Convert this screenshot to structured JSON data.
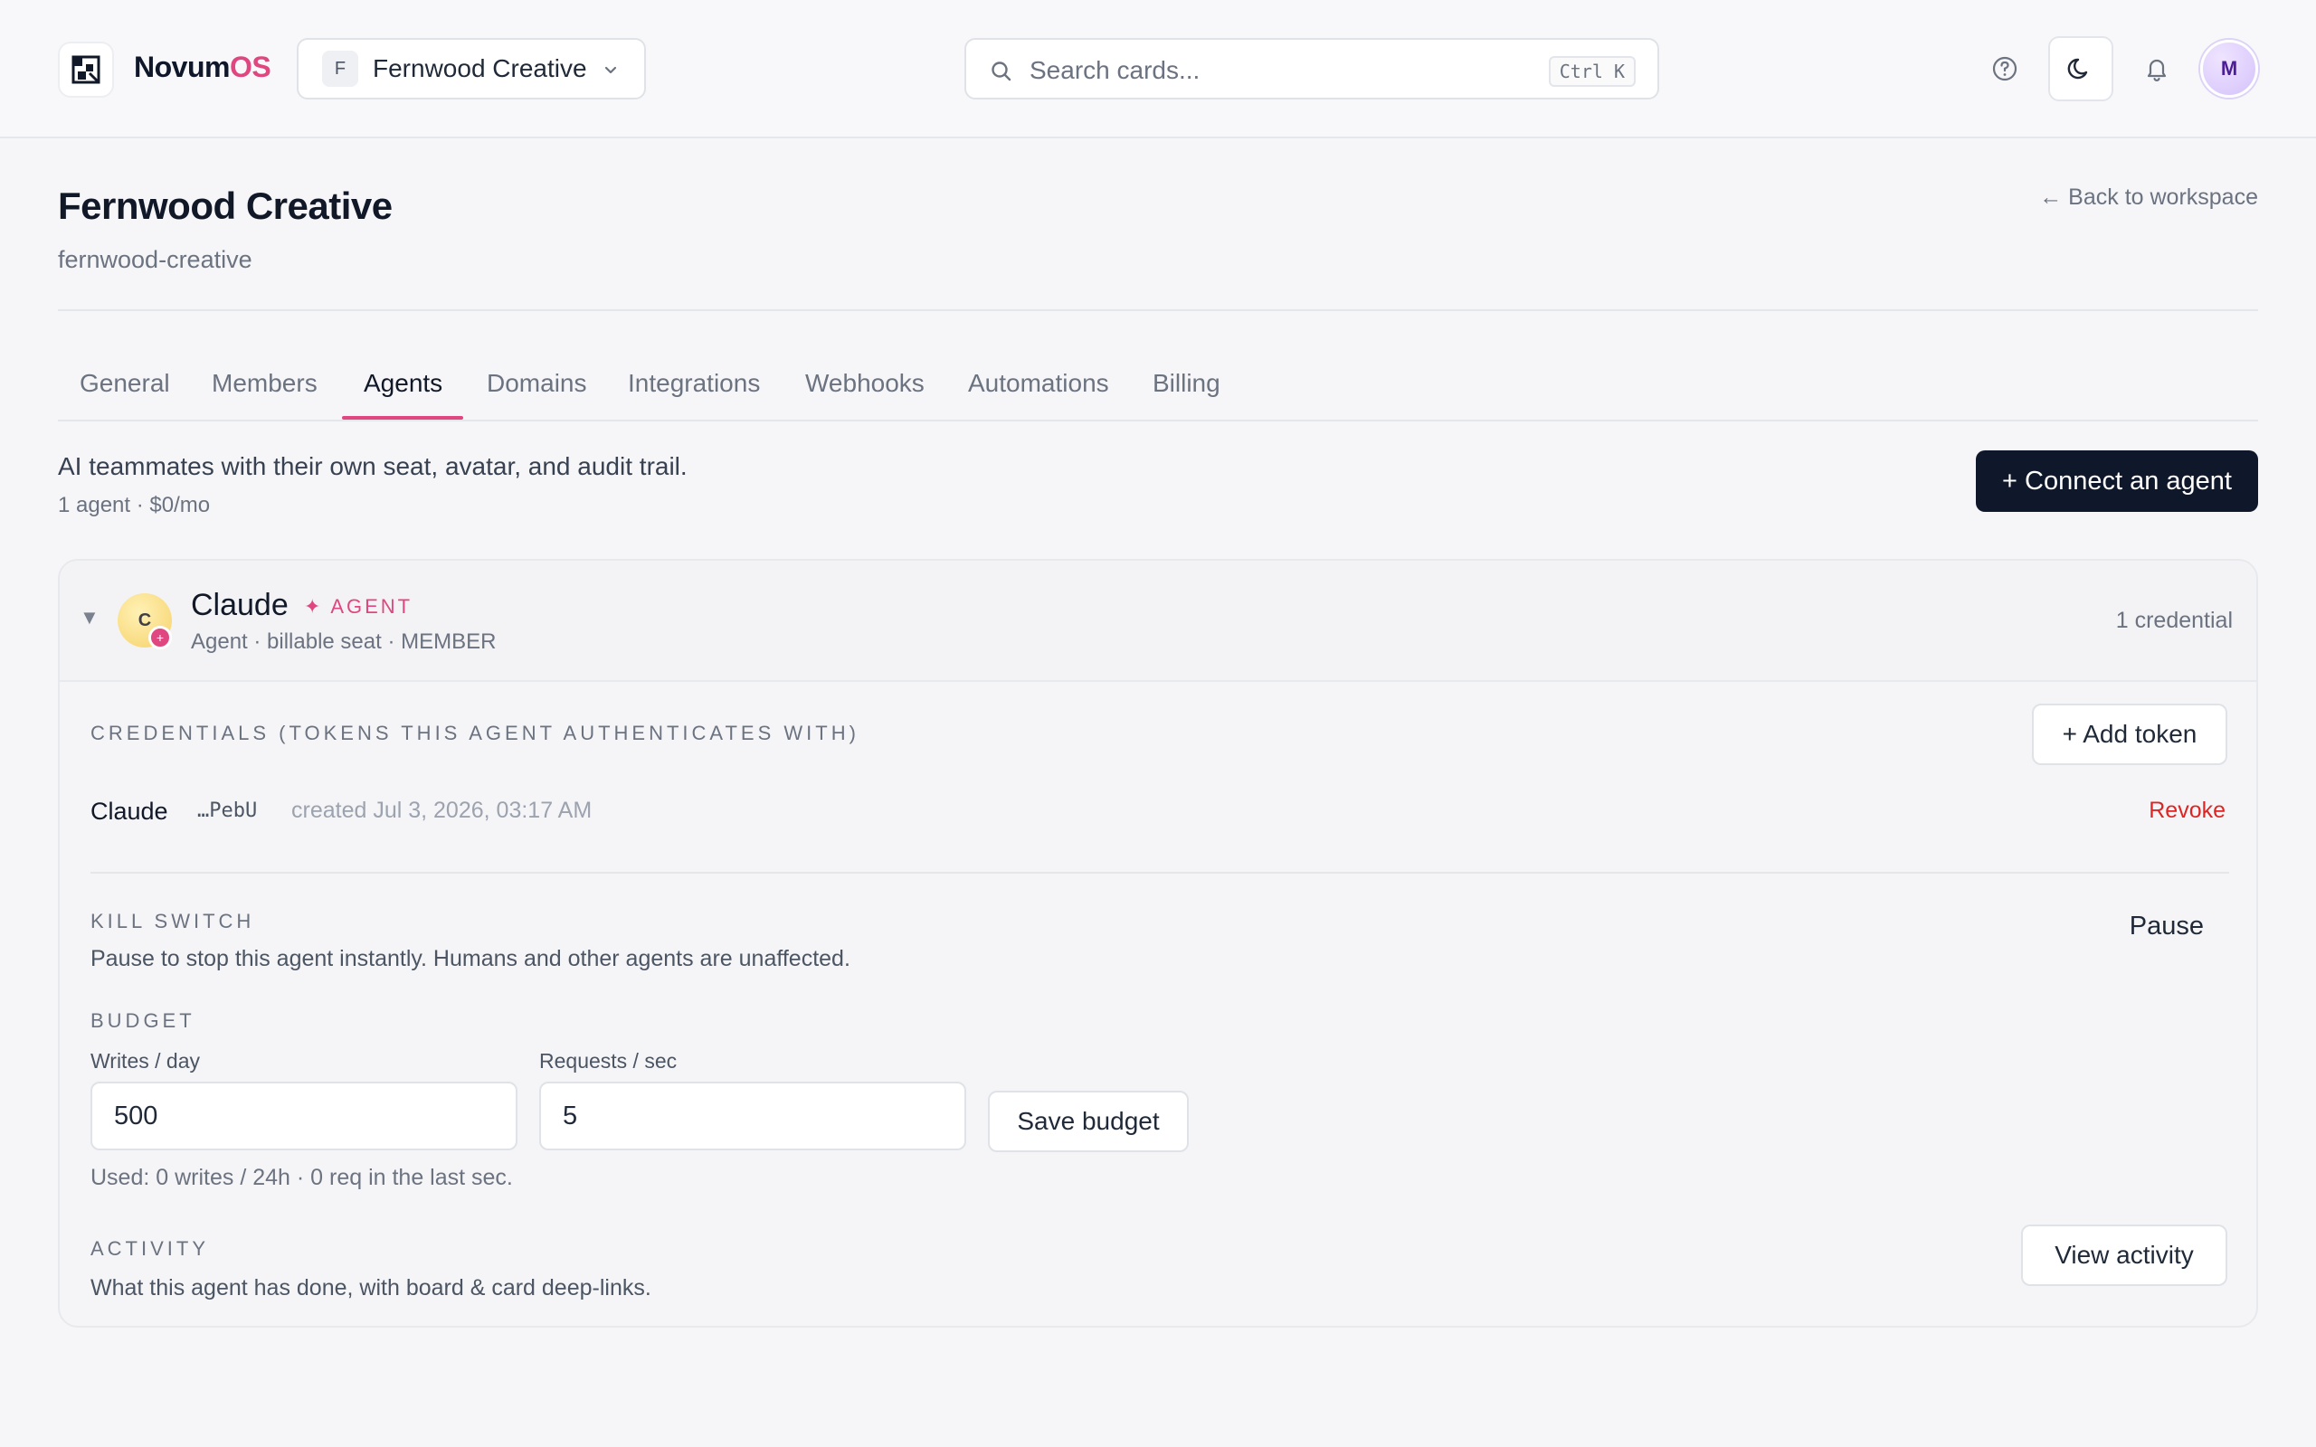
{
  "header": {
    "brand_main": "Novum",
    "brand_accent": "OS",
    "workspace_initial": "F",
    "workspace_name": "Fernwood Creative",
    "search_placeholder": "Search cards...",
    "search_shortcut": "Ctrl K",
    "user_initial": "M",
    "icons": [
      "help-circle-icon",
      "moon-icon",
      "bell-icon"
    ]
  },
  "page": {
    "title": "Fernwood Creative",
    "slug": "fernwood-creative",
    "back_link": "← Back to workspace"
  },
  "tabs": [
    {
      "label": "General",
      "active": false
    },
    {
      "label": "Members",
      "active": false
    },
    {
      "label": "Agents",
      "active": true
    },
    {
      "label": "Domains",
      "active": false
    },
    {
      "label": "Integrations",
      "active": false
    },
    {
      "label": "Webhooks",
      "active": false
    },
    {
      "label": "Automations",
      "active": false
    },
    {
      "label": "Billing",
      "active": false
    }
  ],
  "agents_section": {
    "intro": "AI teammates with their own seat, avatar, and audit trail.",
    "summary": "1 agent · $0/mo",
    "connect_button": "+ Connect an agent"
  },
  "agent": {
    "initial": "C",
    "badge": "+",
    "name": "Claude",
    "tag": "✦ AGENT",
    "meta": "Agent · billable seat · MEMBER",
    "credential_count": "1 credential",
    "credentials": {
      "label": "CREDENTIALS (TOKENS THIS AGENT AUTHENTICATES WITH)",
      "add_button": "+ Add token",
      "items": [
        {
          "name": "Claude",
          "token": "…PebU",
          "created": "created Jul 3, 2026, 03:17 AM",
          "action": "Revoke"
        }
      ]
    },
    "kill_switch": {
      "label": "KILL SWITCH",
      "description": "Pause to stop this agent instantly. Humans and other agents are unaffected.",
      "button": "Pause"
    },
    "budget": {
      "label": "BUDGET",
      "writes_label": "Writes / day",
      "writes_value": "500",
      "requests_label": "Requests / sec",
      "requests_value": "5",
      "save_button": "Save budget",
      "usage": "Used: 0 writes / 24h · 0 req in the last sec."
    },
    "activity": {
      "label": "ACTIVITY",
      "description": "What this agent has done, with board & card deep-links.",
      "button": "View activity"
    }
  },
  "colors": {
    "accent": "#e0467f",
    "primary_button": "#0f172a",
    "danger": "#dc2626"
  }
}
